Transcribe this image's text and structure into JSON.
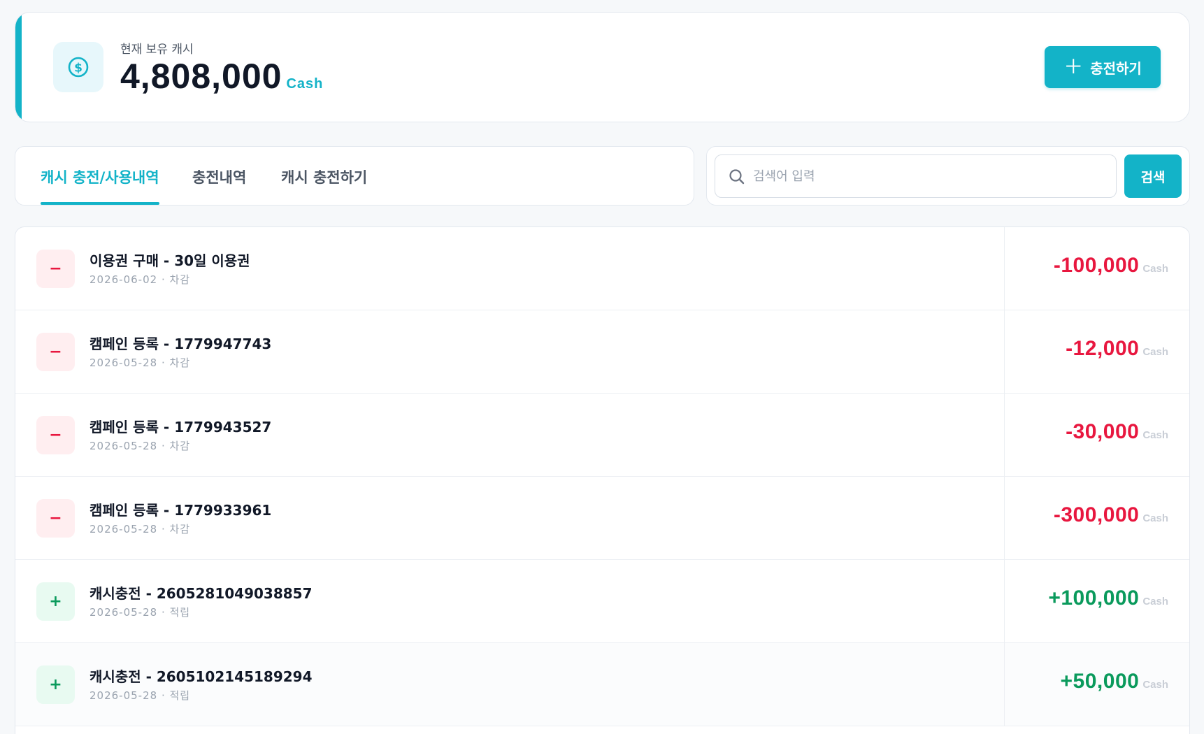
{
  "balance": {
    "label": "현재 보유 캐시",
    "amount": "4,808,000",
    "unit": "Cash",
    "icon": "dollar-coin-icon",
    "charge_button": "충전하기"
  },
  "tabs": [
    {
      "label": "캐시 충전/사용내역",
      "active": true
    },
    {
      "label": "충전내역",
      "active": false
    },
    {
      "label": "캐시 충전하기",
      "active": false
    }
  ],
  "search": {
    "placeholder": "검색어 입력",
    "value": "",
    "button": "검색"
  },
  "transactions": [
    {
      "type": "debit",
      "sign": "−",
      "title": "이용권 구매 - 30일 이용권",
      "meta": "2026-06-02 · 차감",
      "amount": "-100,000",
      "unit": "Cash"
    },
    {
      "type": "debit",
      "sign": "−",
      "title": "캠페인 등록 - 1779947743",
      "meta": "2026-05-28 · 차감",
      "amount": "-12,000",
      "unit": "Cash"
    },
    {
      "type": "debit",
      "sign": "−",
      "title": "캠페인 등록 - 1779943527",
      "meta": "2026-05-28 · 차감",
      "amount": "-30,000",
      "unit": "Cash"
    },
    {
      "type": "debit",
      "sign": "−",
      "title": "캠페인 등록 - 1779933961",
      "meta": "2026-05-28 · 차감",
      "amount": "-300,000",
      "unit": "Cash"
    },
    {
      "type": "credit",
      "sign": "+",
      "title": "캐시충전 - 2605281049038857",
      "meta": "2026-05-28 · 적립",
      "amount": "+100,000",
      "unit": "Cash"
    },
    {
      "type": "credit",
      "sign": "+",
      "title": "캐시충전 - 2605102145189294",
      "meta": "2026-05-28 · 적립",
      "amount": "+50,000",
      "unit": "Cash"
    }
  ],
  "colors": {
    "accent": "#13b3c8",
    "debit": "#e8173f",
    "credit": "#0a9a5c"
  }
}
